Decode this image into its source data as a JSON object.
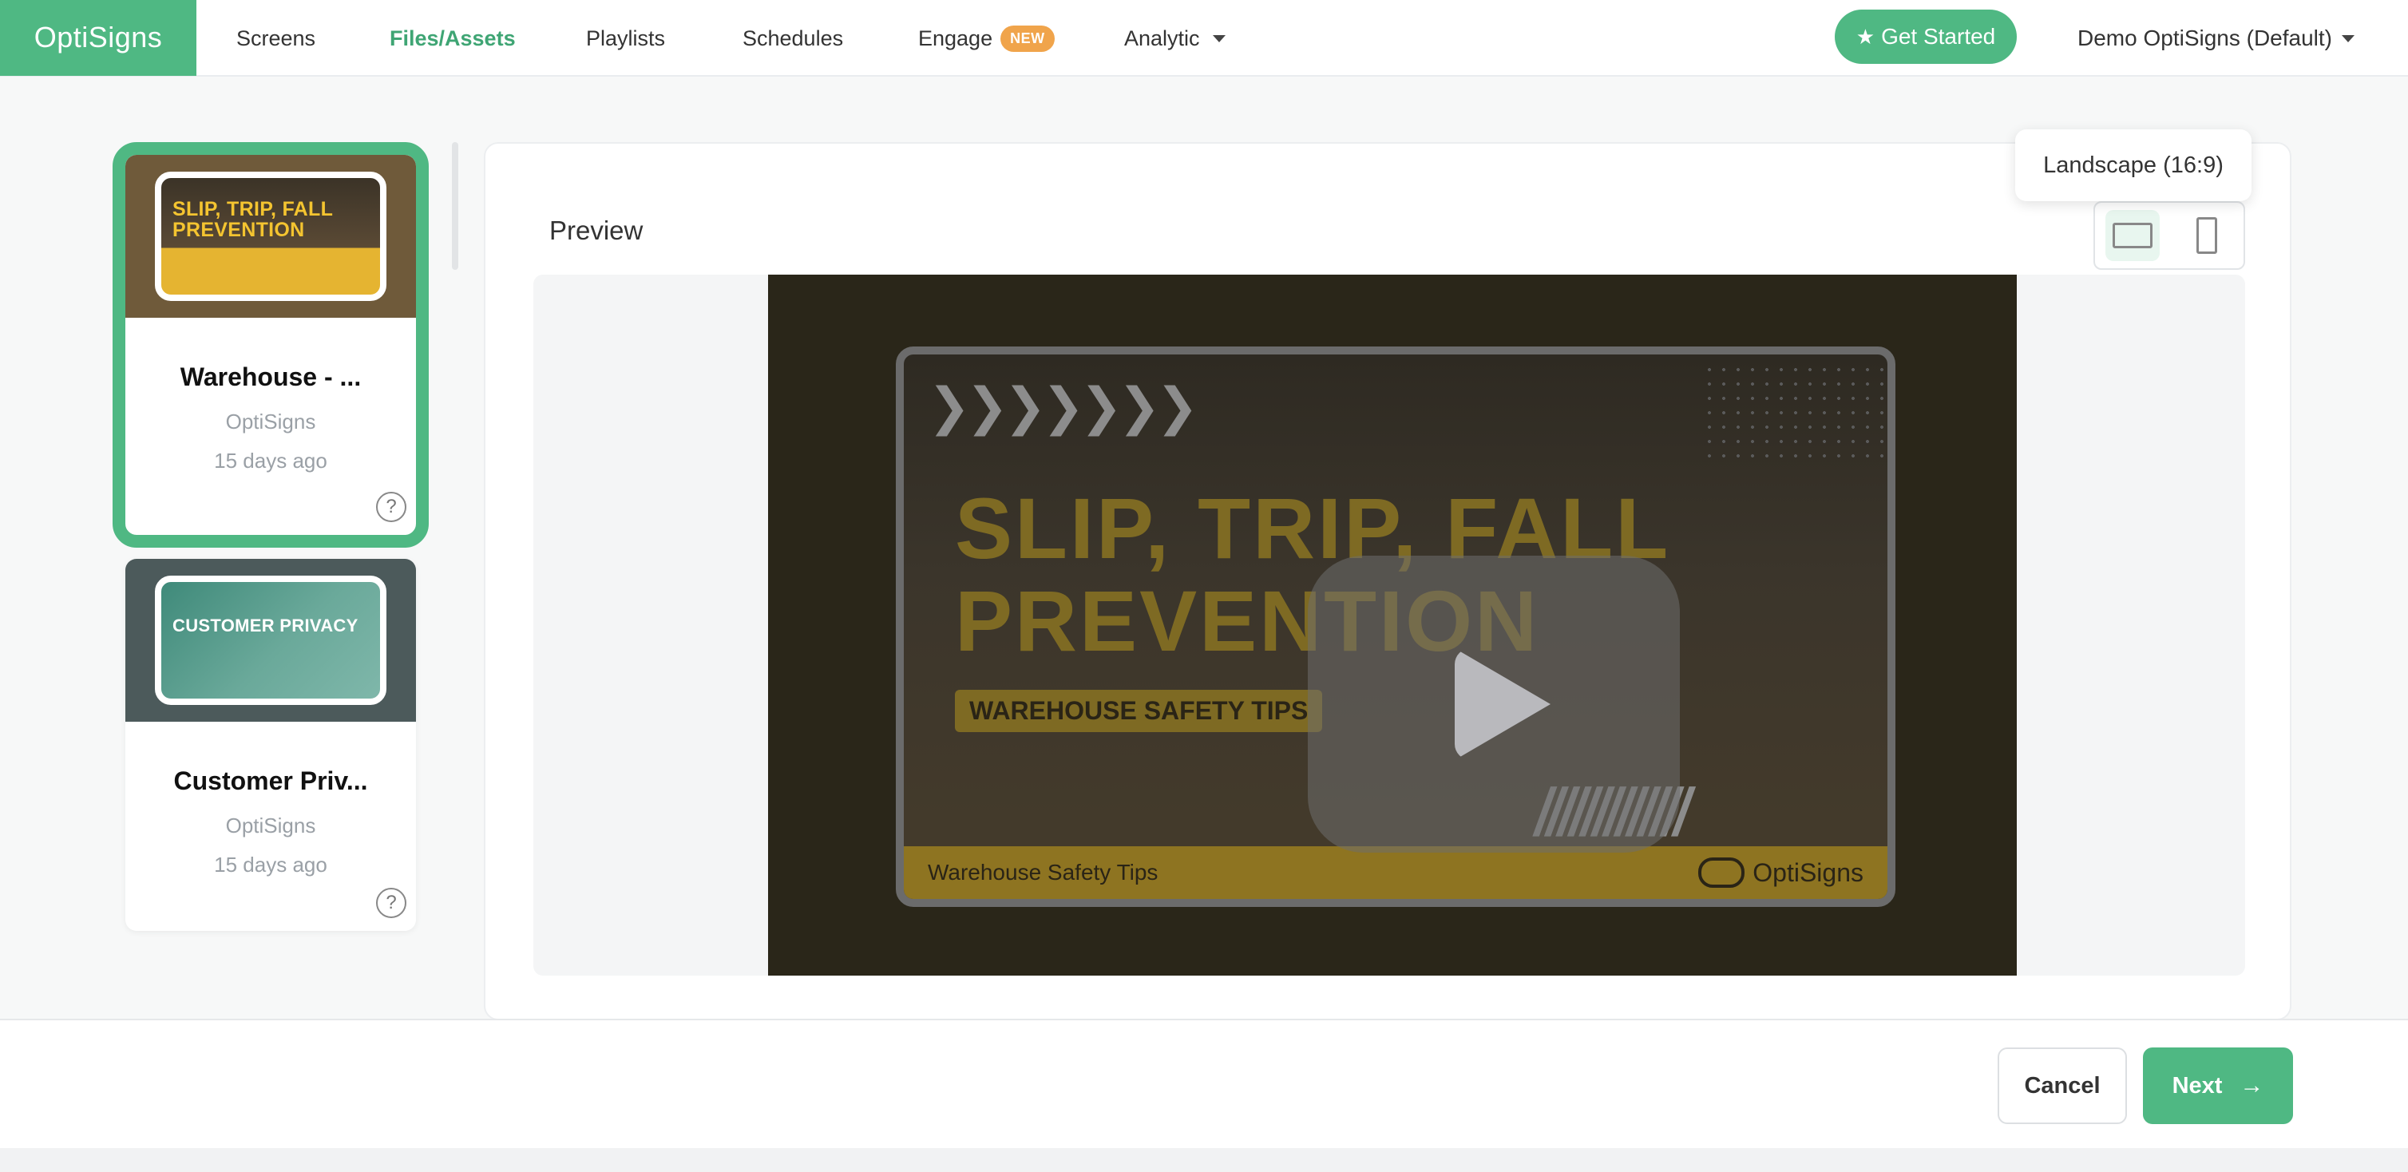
{
  "nav": {
    "brand": "OptiSigns",
    "items": [
      {
        "label": "Screens"
      },
      {
        "label": "Files/Assets",
        "active": true
      },
      {
        "label": "Playlists"
      },
      {
        "label": "Schedules"
      },
      {
        "label": "Engage",
        "badge": "NEW"
      },
      {
        "label": "Analytic"
      }
    ],
    "get_started": "Get Started",
    "account": "Demo OptiSigns (Default)"
  },
  "assets": [
    {
      "title": "Warehouse - ...",
      "owner": "OptiSigns",
      "date": "15 days ago",
      "thumb_text": "SLIP, TRIP, FALL PREVENTION",
      "selected": true
    },
    {
      "title": "Customer Priv...",
      "owner": "OptiSigns",
      "date": "15 days ago",
      "thumb_text": "CUSTOMER PRIVACY",
      "selected": false
    }
  ],
  "preview": {
    "label": "Preview",
    "orientation_tooltip": "Landscape (16:9)",
    "video": {
      "title_line1": "SLIP, TRIP, FALL",
      "title_line2": "PREVENTION",
      "subtitle": "WAREHOUSE SAFETY TIPS",
      "footer_left": "Warehouse Safety Tips",
      "footer_right": "OptiSigns"
    }
  },
  "footer": {
    "cancel": "Cancel",
    "next": "Next"
  },
  "colors": {
    "brand_green": "#4fb883",
    "badge_orange": "#f0a44b"
  },
  "icons": {
    "get_started": "star-icon",
    "help": "question-circle-icon",
    "next": "arrow-right-icon",
    "orientation": [
      "landscape-icon",
      "portrait-icon"
    ],
    "play": "play-icon"
  }
}
